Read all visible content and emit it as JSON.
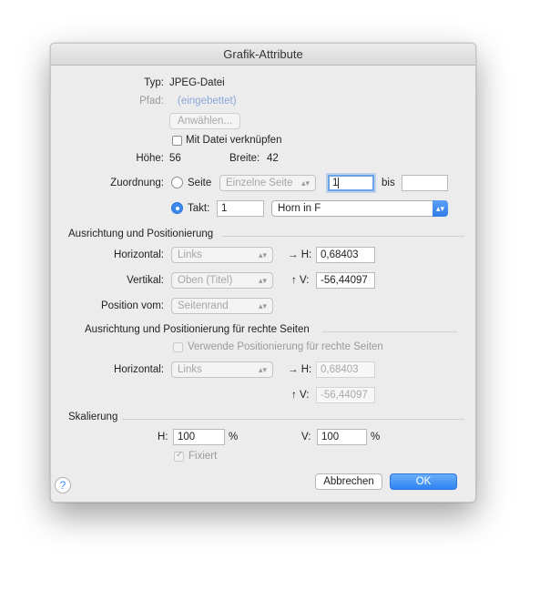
{
  "window": {
    "title": "Grafik-Attribute"
  },
  "info": {
    "typ_label": "Typ:",
    "typ_value": "JPEG-Datei",
    "pfad_label": "Pfad:",
    "pfad_value": "(eingebettet)",
    "choose_button": "Anwählen...",
    "link_checkbox": "Mit Datei verknüpfen",
    "height_label": "Höhe:",
    "height_value": "56",
    "width_label": "Breite:",
    "width_value": "42"
  },
  "assignment": {
    "label": "Zuordnung:",
    "page_radio": "Seite",
    "page_popup": "Einzelne Seite",
    "from_value": "1",
    "to_label": "bis",
    "to_value": "",
    "measure_radio": "Takt:",
    "measure_value": "1",
    "instrument_popup": "Horn in F"
  },
  "alignment": {
    "section_title": "Ausrichtung und Positionierung",
    "horizontal_label": "Horizontal:",
    "horizontal_popup": "Links",
    "h_label": "→ H:",
    "h_value": "0,68403",
    "vertical_label": "Vertikal:",
    "vertical_popup": "Oben (Titel)",
    "v_label": "↑ V:",
    "v_value": "-56,44097",
    "position_label": "Position vom:",
    "position_popup": "Seitenrand"
  },
  "right_pages": {
    "section_title": "Ausrichtung und Positionierung für rechte Seiten",
    "use_checkbox": "Verwende Positionierung für rechte Seiten",
    "horizontal_label": "Horizontal:",
    "horizontal_popup": "Links",
    "h_label": "→ H:",
    "h_value": "0,68403",
    "v_label": "↑ V:",
    "v_value": "-56,44097"
  },
  "scaling": {
    "section_title": "Skalierung",
    "h_label": "H:",
    "h_value": "100",
    "h_unit": "%",
    "v_label": "V:",
    "v_value": "100",
    "v_unit": "%",
    "fixed_checkbox": "Fixiert"
  },
  "buttons": {
    "help": "?",
    "cancel": "Abbrechen",
    "ok": "OK"
  },
  "icons": {
    "popup_chevron": "chevron-updown-icon",
    "help": "help-icon"
  }
}
